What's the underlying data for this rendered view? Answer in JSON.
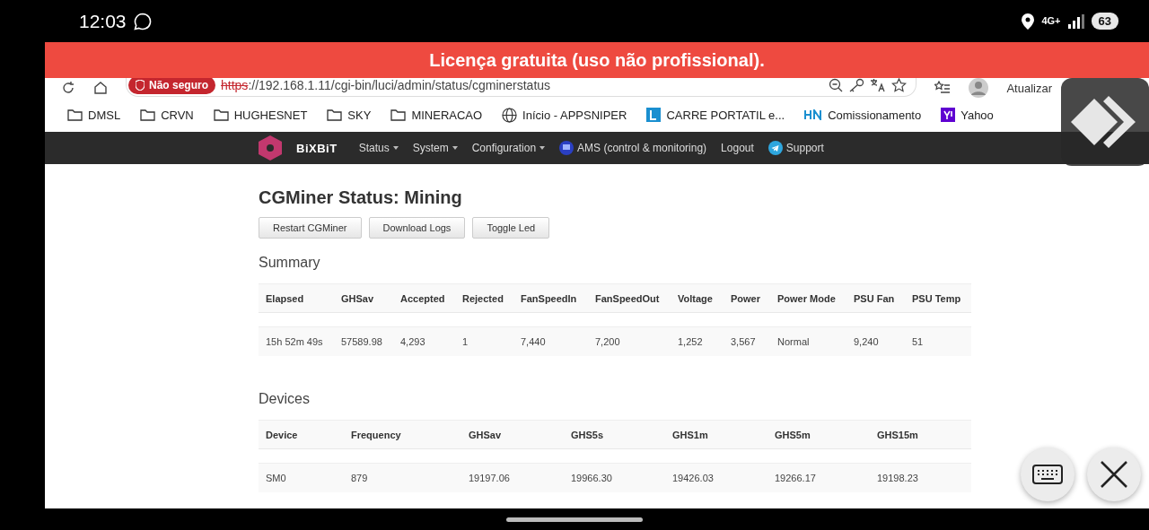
{
  "phone_status": {
    "time": "12:03",
    "network": "4G+",
    "battery": "63"
  },
  "banner": "Licença gratuita (uso não profissional).",
  "browser": {
    "security_badge": "Não seguro",
    "url_scheme": "https",
    "url_rest": "://192.168.1.11/cgi-bin/luci/admin/status/cgminerstatus",
    "update_button": "Atualizar"
  },
  "bookmarks": [
    {
      "kind": "folder",
      "label": "DMSL"
    },
    {
      "kind": "folder",
      "label": "CRVN"
    },
    {
      "kind": "folder",
      "label": "HUGHESNET"
    },
    {
      "kind": "folder",
      "label": "SKY"
    },
    {
      "kind": "folder",
      "label": "MINERACAO"
    },
    {
      "kind": "globe",
      "label": "Início - APPSNIPER"
    },
    {
      "kind": "tile",
      "label": "CARRE PORTATIL e..."
    },
    {
      "kind": "hn",
      "label": "Comissionamento"
    },
    {
      "kind": "yahoo",
      "label": "Yahoo"
    }
  ],
  "nav": {
    "brand": "BiXBiT",
    "items": [
      {
        "kind": "menu",
        "label": "Status"
      },
      {
        "kind": "menu",
        "label": "System"
      },
      {
        "kind": "menu",
        "label": "Configuration"
      },
      {
        "kind": "ams",
        "label": "AMS (control & monitoring)"
      },
      {
        "kind": "link",
        "label": "Logout"
      },
      {
        "kind": "support",
        "label": "Support"
      }
    ]
  },
  "page": {
    "title": "CGMiner Status: Mining",
    "buttons": [
      "Restart CGMiner",
      "Download Logs",
      "Toggle Led"
    ],
    "summary": {
      "heading": "Summary",
      "columns": [
        "Elapsed",
        "GHSav",
        "Accepted",
        "Rejected",
        "FanSpeedIn",
        "FanSpeedOut",
        "Voltage",
        "Power",
        "Power Mode",
        "PSU Fan",
        "PSU Temp"
      ],
      "rows": [
        [
          "15h 52m 49s",
          "57589.98",
          "4,293",
          "1",
          "7,440",
          "7,200",
          "1,252",
          "3,567",
          "Normal",
          "9,240",
          "51"
        ]
      ]
    },
    "devices": {
      "heading": "Devices",
      "columns": [
        "Device",
        "Frequency",
        "GHSav",
        "GHS5s",
        "GHS1m",
        "GHS5m",
        "GHS15m"
      ],
      "rows": [
        [
          "SM0",
          "879",
          "19197.06",
          "19966.30",
          "19426.03",
          "19266.17",
          "19198.23"
        ]
      ]
    }
  }
}
